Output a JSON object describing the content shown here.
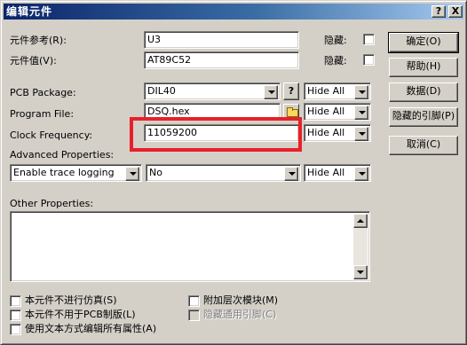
{
  "dialog": {
    "title": "编辑元件",
    "help_glyph": "?",
    "close_glyph": "X"
  },
  "fields": {
    "ref_label": "元件参考(R):",
    "ref_value": "U3",
    "value_label": "元件值(V):",
    "value_value": "AT89C52",
    "hidden_label": "隐藏:",
    "pcb_label": "PCB Package:",
    "pcb_value": "DIL40",
    "pcb_help": "?",
    "program_label": "Program File:",
    "program_value": "DSQ.hex",
    "clock_label": "Clock Frequency:",
    "clock_value": "11059200",
    "advanced_label": "Advanced Properties:",
    "advanced_prop": "Enable trace logging",
    "advanced_value": "No",
    "visibility": "Hide All",
    "other_label": "Other Properties:"
  },
  "checkboxes": {
    "no_sim": "本元件不进行仿真(S)",
    "no_pcb": "本元件不用于PCB制版(L)",
    "text_edit": "使用文本方式编辑所有属性(A)",
    "attach_hier": "附加层次模块(M)",
    "hide_pins": "隐藏通用引脚(C)"
  },
  "buttons": {
    "ok": "确定(O)",
    "help": "帮助(H)",
    "data": "数据(D)",
    "hidden_pins": "隐藏的引脚(P)",
    "cancel": "取消(C)"
  }
}
